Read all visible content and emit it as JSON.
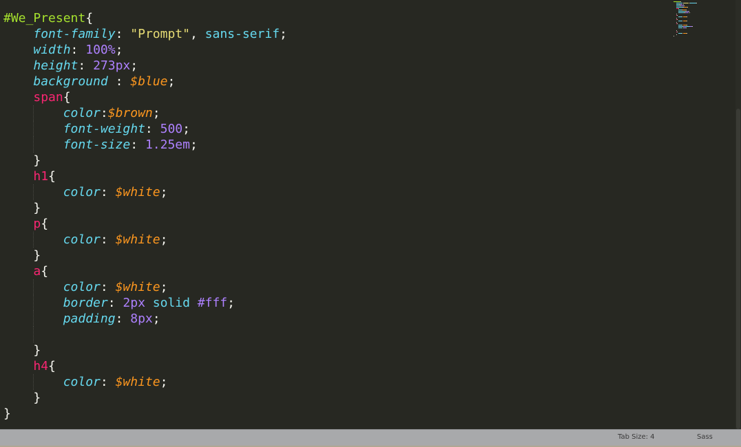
{
  "editor": {
    "language": "Sass",
    "lines": [
      {
        "indent": 0,
        "tokens": [
          {
            "t": "#We_Present",
            "c": "kw"
          },
          {
            "t": "{",
            "c": "pun"
          }
        ]
      },
      {
        "indent": 1,
        "tokens": [
          {
            "t": "font-family",
            "c": "prop"
          },
          {
            "t": ": ",
            "c": "pun"
          },
          {
            "t": "\"Prompt\"",
            "c": "str"
          },
          {
            "t": ", ",
            "c": "pun"
          },
          {
            "t": "sans-serif",
            "c": "plain"
          },
          {
            "t": ";",
            "c": "pun"
          }
        ]
      },
      {
        "indent": 1,
        "tokens": [
          {
            "t": "width",
            "c": "prop"
          },
          {
            "t": ": ",
            "c": "pun"
          },
          {
            "t": "100%",
            "c": "num"
          },
          {
            "t": ";",
            "c": "pun"
          }
        ]
      },
      {
        "indent": 1,
        "tokens": [
          {
            "t": "height",
            "c": "prop"
          },
          {
            "t": ": ",
            "c": "pun"
          },
          {
            "t": "273px",
            "c": "num"
          },
          {
            "t": ";",
            "c": "pun"
          }
        ]
      },
      {
        "indent": 1,
        "tokens": [
          {
            "t": "background",
            "c": "prop"
          },
          {
            "t": " : ",
            "c": "pun"
          },
          {
            "t": "$blue",
            "c": "var"
          },
          {
            "t": ";",
            "c": "pun"
          }
        ]
      },
      {
        "indent": 1,
        "tokens": [
          {
            "t": "span",
            "c": "tag"
          },
          {
            "t": "{",
            "c": "pun"
          }
        ]
      },
      {
        "indent": 2,
        "tokens": [
          {
            "t": "color",
            "c": "prop"
          },
          {
            "t": ":",
            "c": "pun"
          },
          {
            "t": "$brown",
            "c": "var"
          },
          {
            "t": ";",
            "c": "pun"
          }
        ]
      },
      {
        "indent": 2,
        "tokens": [
          {
            "t": "font-weight",
            "c": "prop"
          },
          {
            "t": ": ",
            "c": "pun"
          },
          {
            "t": "500",
            "c": "num"
          },
          {
            "t": ";",
            "c": "pun"
          }
        ]
      },
      {
        "indent": 2,
        "tokens": [
          {
            "t": "font-size",
            "c": "prop"
          },
          {
            "t": ": ",
            "c": "pun"
          },
          {
            "t": "1.25em",
            "c": "num"
          },
          {
            "t": ";",
            "c": "pun"
          }
        ]
      },
      {
        "indent": 1,
        "tokens": [
          {
            "t": "}",
            "c": "pun"
          }
        ]
      },
      {
        "indent": 1,
        "tokens": [
          {
            "t": "h1",
            "c": "tag"
          },
          {
            "t": "{",
            "c": "pun"
          }
        ]
      },
      {
        "indent": 2,
        "tokens": [
          {
            "t": "color",
            "c": "prop"
          },
          {
            "t": ": ",
            "c": "pun"
          },
          {
            "t": "$white",
            "c": "var"
          },
          {
            "t": ";",
            "c": "pun"
          }
        ]
      },
      {
        "indent": 1,
        "tokens": [
          {
            "t": "}",
            "c": "pun"
          }
        ]
      },
      {
        "indent": 1,
        "tokens": [
          {
            "t": "p",
            "c": "tag"
          },
          {
            "t": "{",
            "c": "pun"
          }
        ]
      },
      {
        "indent": 2,
        "tokens": [
          {
            "t": "color",
            "c": "prop"
          },
          {
            "t": ": ",
            "c": "pun"
          },
          {
            "t": "$white",
            "c": "var"
          },
          {
            "t": ";",
            "c": "pun"
          }
        ]
      },
      {
        "indent": 1,
        "tokens": [
          {
            "t": "}",
            "c": "pun"
          }
        ]
      },
      {
        "indent": 1,
        "tokens": [
          {
            "t": "a",
            "c": "tag"
          },
          {
            "t": "{",
            "c": "pun"
          }
        ]
      },
      {
        "indent": 2,
        "tokens": [
          {
            "t": "color",
            "c": "prop"
          },
          {
            "t": ": ",
            "c": "pun"
          },
          {
            "t": "$white",
            "c": "var"
          },
          {
            "t": ";",
            "c": "pun"
          }
        ]
      },
      {
        "indent": 2,
        "tokens": [
          {
            "t": "border",
            "c": "prop"
          },
          {
            "t": ": ",
            "c": "pun"
          },
          {
            "t": "2px",
            "c": "num"
          },
          {
            "t": " solid ",
            "c": "plain"
          },
          {
            "t": "#fff",
            "c": "num"
          },
          {
            "t": ";",
            "c": "pun"
          }
        ]
      },
      {
        "indent": 2,
        "tokens": [
          {
            "t": "padding",
            "c": "prop"
          },
          {
            "t": ": ",
            "c": "pun"
          },
          {
            "t": "8px",
            "c": "num"
          },
          {
            "t": ";",
            "c": "pun"
          }
        ]
      },
      {
        "indent": 2,
        "tokens": []
      },
      {
        "indent": 1,
        "tokens": [
          {
            "t": "}",
            "c": "pun"
          }
        ]
      },
      {
        "indent": 1,
        "tokens": [
          {
            "t": "h4",
            "c": "tag"
          },
          {
            "t": "{",
            "c": "pun"
          }
        ]
      },
      {
        "indent": 2,
        "tokens": [
          {
            "t": "color",
            "c": "prop"
          },
          {
            "t": ": ",
            "c": "pun"
          },
          {
            "t": "$white",
            "c": "var"
          },
          {
            "t": ";",
            "c": "pun"
          }
        ]
      },
      {
        "indent": 1,
        "tokens": [
          {
            "t": "}",
            "c": "pun"
          }
        ]
      },
      {
        "indent": 0,
        "tokens": [
          {
            "t": "}",
            "c": "pun"
          }
        ]
      }
    ]
  },
  "statusbar": {
    "tab_size": "Tab Size: 4",
    "syntax": "Sass"
  },
  "colors": {
    "background": "#272822",
    "selector": "#a6e22e",
    "tag": "#f92672",
    "property": "#66d9ef",
    "number": "#ae81ff",
    "string": "#e6db74",
    "variable": "#fd971f",
    "statusbar": "#a8a9ab"
  }
}
